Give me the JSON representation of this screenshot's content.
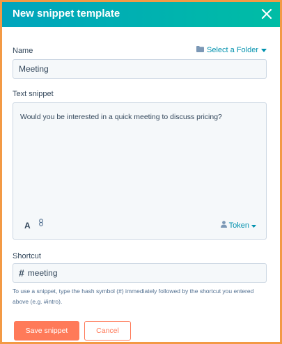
{
  "dialog": {
    "title": "New snippet template",
    "close_icon": "close-icon"
  },
  "name_field": {
    "label": "Name",
    "value": "Meeting",
    "folder_link": "Select a Folder",
    "folder_icon": "folder-icon",
    "caret_icon": "caret-down-icon"
  },
  "snippet_field": {
    "label": "Text snippet",
    "value": "Would you be interested in a quick meeting to discuss pricing?",
    "format_button": "A",
    "link_icon": "link-icon",
    "token_label": "Token",
    "token_icon": "person-icon"
  },
  "shortcut_field": {
    "label": "Shortcut",
    "prefix": "#",
    "value": "meeting",
    "help_text": "To use a snippet, type the hash symbol (#) immediately followed by the shortcut you entered above (e.g. #intro)."
  },
  "actions": {
    "save_label": "Save snippet",
    "cancel_label": "Cancel"
  },
  "colors": {
    "header_start": "#00a4bd",
    "header_end": "#00bda5",
    "accent": "#ff7a59",
    "link": "#0091ae",
    "frame_border": "#f39a45"
  }
}
